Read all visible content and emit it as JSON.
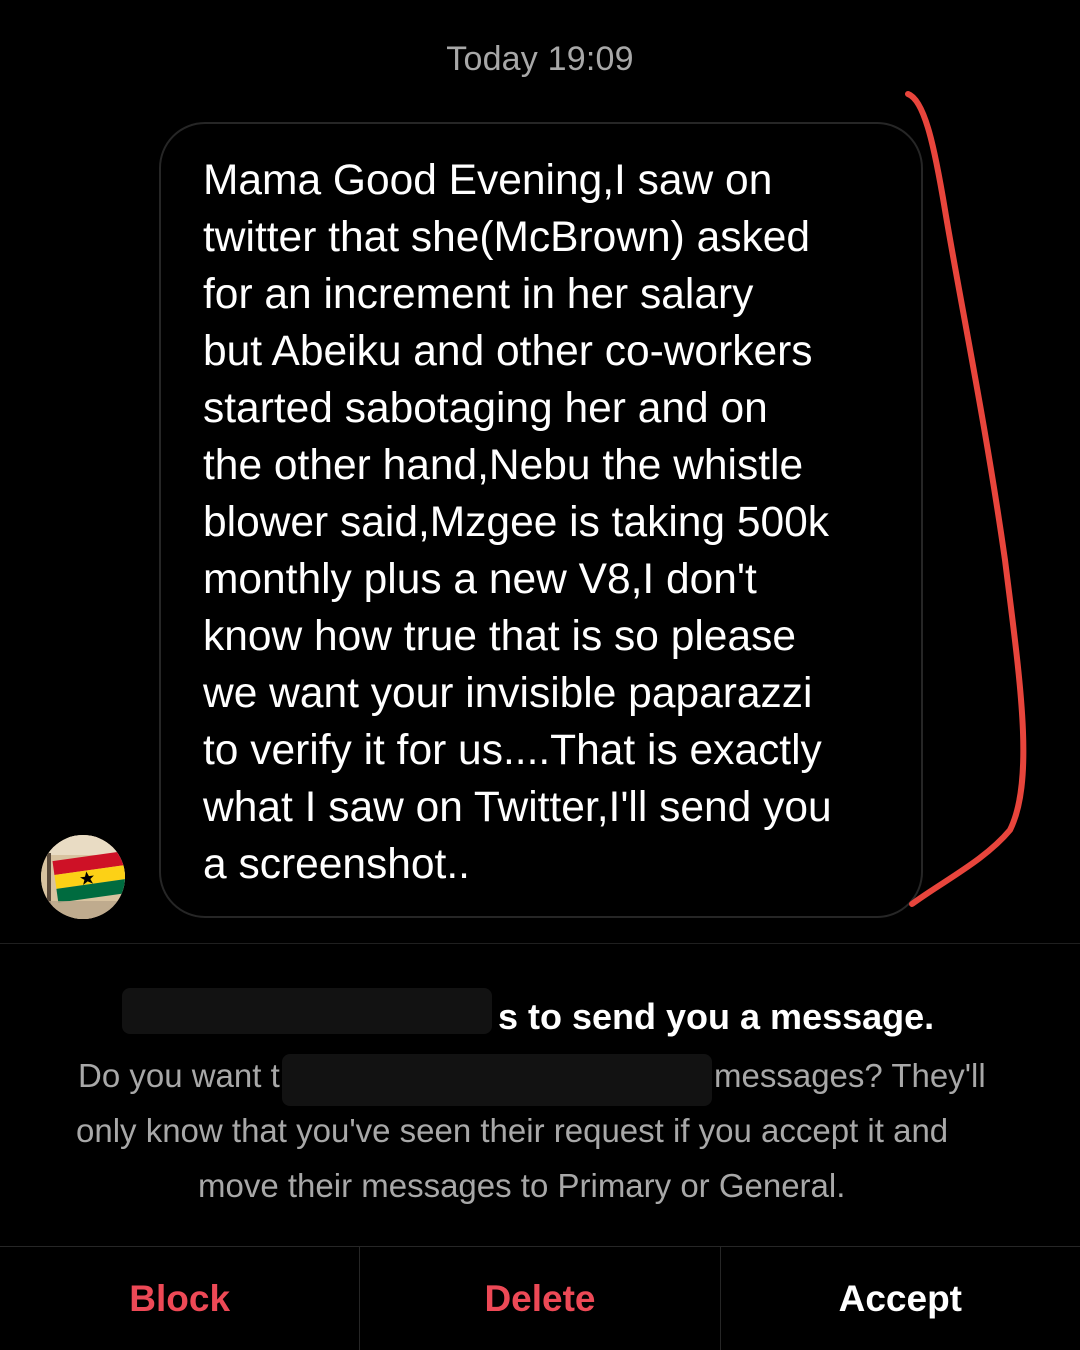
{
  "thread": {
    "timestamp": "Today 19:09"
  },
  "message": {
    "text": "Mama Good Evening,I saw on\ntwitter that she(McBrown) asked\nfor an increment in her salary\nbut Abeiku and other co-workers\nstarted sabotaging her and on\nthe other hand,Nebu the whistle\nblower said,Mzgee is taking 500k\nmonthly plus a new V8,I don't\nknow how true that is so please\nwe want your invisible paparazzi\nto verify it for us....That is exactly\nwhat I saw on Twitter,I'll send you\na screenshot.."
  },
  "sender": {
    "avatar_icon": "ghana-flag-avatar-icon"
  },
  "request": {
    "title_visible": "s to send you a message.",
    "line1_left": "Do you want t",
    "line1_right": "messages? They'll",
    "line2": "only know that you've seen their request if you accept it and",
    "line3": "move their messages to Primary or General."
  },
  "actions": {
    "block_label": "Block",
    "delete_label": "Delete",
    "accept_label": "Accept"
  },
  "colors": {
    "background": "#000000",
    "secondary_text": "#a8a8a8",
    "destructive": "#ed4956",
    "annotation_stroke": "#e8453c",
    "bubble_border": "#262626"
  }
}
